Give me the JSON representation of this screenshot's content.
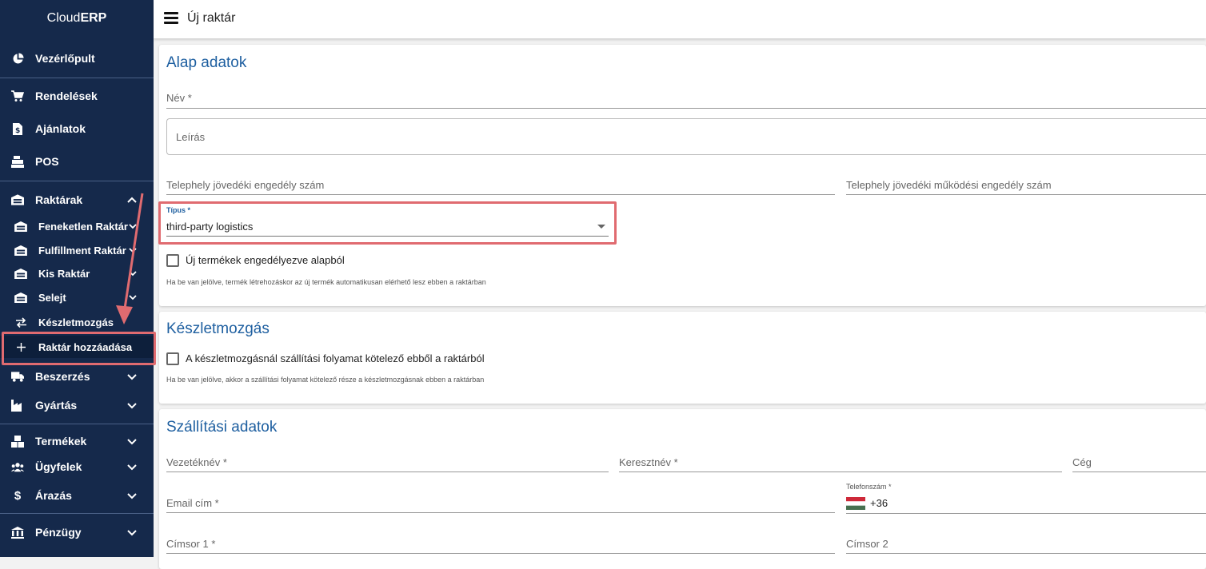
{
  "app": {
    "brand_light": "Cloud",
    "brand_bold": "ERP",
    "page_title": "Új raktár"
  },
  "sidebar": {
    "dashboard": "Vezérlőpult",
    "orders": "Rendelések",
    "quotes": "Ajánlatok",
    "pos": "POS",
    "warehouses": "Raktárak",
    "warehouse_items": [
      "Feneketlen Raktár",
      "Fulfillment Raktár",
      "Kis Raktár",
      "Selejt"
    ],
    "stock_movement": "Készletmozgás",
    "add_warehouse": "Raktár hozzáadása",
    "procurement": "Beszerzés",
    "manufacturing": "Gyártás",
    "products": "Termékek",
    "customers": "Ügyfelek",
    "pricing": "Árazás",
    "finance": "Pénzügy"
  },
  "basic": {
    "title": "Alap adatok",
    "name_label": "Név *",
    "description_label": "Leírás",
    "excise_license_label": "Telephely jövedéki engedély szám",
    "excise_operating_label": "Telephely jövedéki működési engedély szám",
    "type_label": "Típus *",
    "type_value": "third-party logistics",
    "new_products_checkbox": "Új termékek engedélyezve alapból",
    "new_products_hint": "Ha be van jelölve, termék létrehozáskor az új termék automatikusan elérhető lesz ebben a raktárban"
  },
  "stock": {
    "title": "Készletmozgás",
    "shipping_checkbox": "A készletmozgásnál szállítási folyamat kötelező ebből a raktárból",
    "shipping_hint": "Ha be van jelölve, akkor a szállítási folyamat kötelező része a készletmozgásnak ebben a raktárban"
  },
  "shipping": {
    "title": "Szállítási adatok",
    "lastname_label": "Vezetéknév *",
    "firstname_label": "Keresztnév *",
    "company_label": "Cég",
    "email_label": "Email cím *",
    "phone_label": "Telefonszám *",
    "phone_prefix": "+36",
    "address1_label": "Címsor 1 *",
    "address2_label": "Címsor 2"
  },
  "colors": {
    "sidebar_bg": "#15294b",
    "accent_blue": "#1e5fa0",
    "highlight_red": "#e06b70"
  }
}
